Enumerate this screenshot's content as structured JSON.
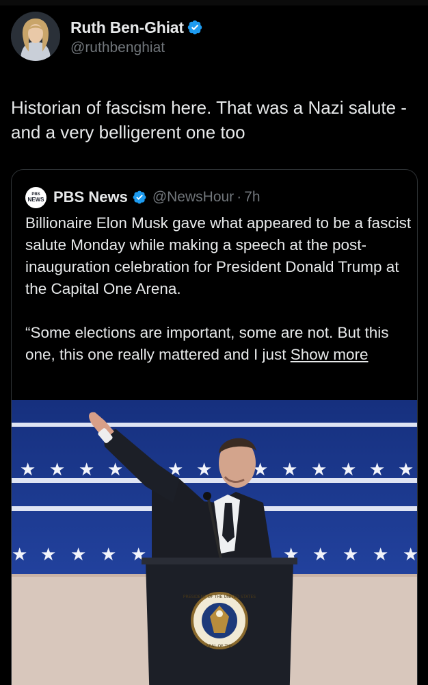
{
  "tweet": {
    "author_name": "Ruth Ben-Ghiat",
    "author_handle": "@ruthbenghiat",
    "text": "Historian of fascism here. That was a Nazi salute - and a very belligerent one too"
  },
  "quoted": {
    "logo_line1": "PBS",
    "logo_line2": "NEWS",
    "author_name": "PBS News",
    "author_handle": "@NewsHour",
    "separator": "·",
    "time": "7h",
    "paragraph1": "Billionaire Elon Musk gave what appeared to be a fascist salute Monday while making a speech at the post-inauguration celebration for President Donald Trump at the Capital One Arena.",
    "paragraph2": "“Some elections are important, some are not. But this one, this one really mattered and I just",
    "show_more": "Show more"
  },
  "seal_text": {
    "top": "PRESIDENT OF THE UNITED STATES",
    "bottom": "· SEAL OF THE ·"
  },
  "colors": {
    "background": "#000000",
    "text_primary": "#e7e9ea",
    "text_secondary": "#71767b",
    "verified": "#1d9bf0",
    "border": "#2f3336",
    "stage_blue": "#2446a8"
  },
  "icons": [
    "verified-badge-icon",
    "pbs-news-logo"
  ]
}
